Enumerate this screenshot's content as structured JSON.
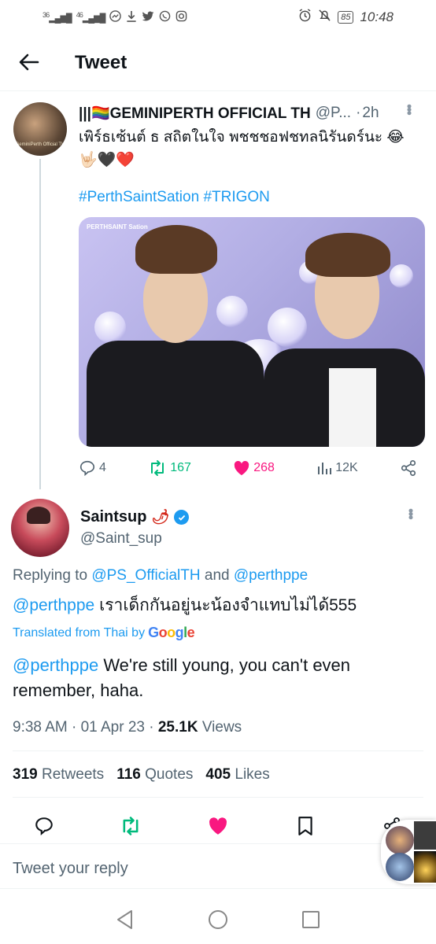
{
  "status_bar": {
    "signal_left": "36",
    "signal_right": "46",
    "battery": "85",
    "time": "10:48"
  },
  "header": {
    "title": "Tweet"
  },
  "parent_tweet": {
    "name": "|||🏳️‍🌈GEMINIPERTH OFFICIAL TH",
    "handle": "@P...",
    "separator": "·",
    "time": "2h",
    "text": "เพิร์ธเซ้นต์ ธ สถิตในใจ พชชชอฟชทลนิรันดร์นะ 😂 🤟🏻🖤❤️",
    "hashtags": "#PerthSaintSation #TRIGON",
    "media_caption": "PERTHSAINT Sation",
    "avatar_caption": "GeminiPerth Official TH",
    "stats": {
      "replies": "4",
      "retweets": "167",
      "likes": "268",
      "views": "12K"
    }
  },
  "main_tweet": {
    "name": "Saintsup",
    "emoji": "🌶",
    "handle": "@Saint_sup",
    "replying_prefix": "Replying to",
    "replying_user1": "@PS_OfficialTH",
    "replying_and": "and",
    "replying_user2": "@perthppe",
    "mention": "@perthppe",
    "text_thai": "เราเด็กกันอยู่นะน้องจำแทบไม่ได้555",
    "translated_label": "Translated from Thai by",
    "translation_mention": "@perthppe",
    "translation_text": "We're still young, you can't even remember, haha.",
    "time": "9:38 AM",
    "dot": "·",
    "date": "01 Apr 23",
    "views_count": "25.1K",
    "views_label": "Views",
    "retweets_count": "319",
    "retweets_label": "Retweets",
    "quotes_count": "116",
    "quotes_label": "Quotes",
    "likes_count": "405",
    "likes_label": "Likes"
  },
  "reply_box": {
    "placeholder": "Tweet your reply"
  },
  "colors": {
    "accent": "#1d9bf0",
    "retweet": "#00ba7c",
    "like": "#f91880",
    "muted": "#536471"
  }
}
